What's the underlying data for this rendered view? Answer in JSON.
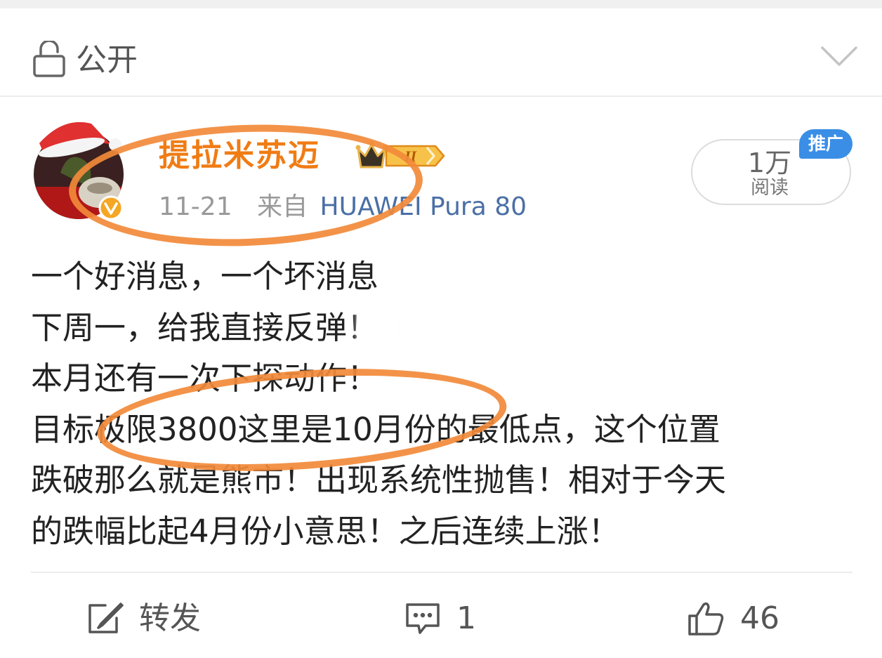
{
  "privacy": {
    "label": "公开"
  },
  "author": {
    "name": "提拉米苏迈"
  },
  "post_meta": {
    "date": "11-21",
    "from_label": "来自",
    "device": "HUAWEI Pura 80"
  },
  "stats": {
    "read_count": "1万",
    "read_label": "阅读",
    "promo_badge": "推广"
  },
  "post": {
    "lines": [
      "一个好消息，一个坏消息",
      "下周一，给我直接反弹！",
      "本月还有一次下探动作！",
      "目标极限3800这里是10月份的最低点，这个位置",
      "跌破那么就是熊市！出现系统性抛售！相对于今天",
      "的跌幅比起4月份小意思！之后连续上涨！"
    ]
  },
  "actions": {
    "repost_label": "转发",
    "comment_count": "1",
    "like_count": "46"
  },
  "colors": {
    "username": "#f07c14",
    "annotation": "#f28a3a",
    "device_link": "#4a6fa5",
    "promo_badge": "#3a8ee6"
  }
}
